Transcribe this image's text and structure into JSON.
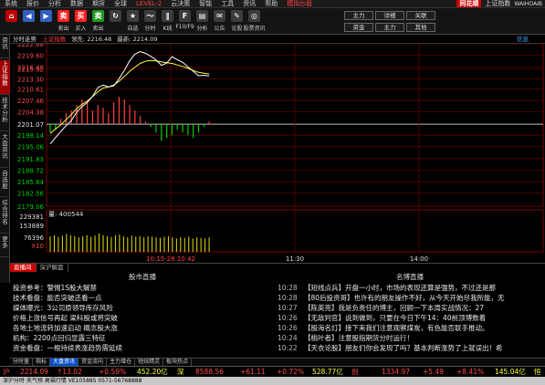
{
  "menu": {
    "items": [
      "系统",
      "报价",
      "分析",
      "数据",
      "期货",
      "全球",
      "LEVEL-2",
      "云决策",
      "智能",
      "工具",
      "资讯",
      "帮助"
    ],
    "highlight": "模拟炒股",
    "logo": "同花顺",
    "title": "上证指数",
    "right": "WAIHOAIB"
  },
  "toolbar": {
    "buttons": [
      {
        "label": "",
        "color": "#c00000",
        "glyph": "⌂"
      },
      {
        "label": "",
        "color": "#3060c0",
        "glyph": "◀"
      },
      {
        "label": "",
        "color": "#3060c0",
        "glyph": "▶"
      },
      {
        "label": "卖出",
        "color": "#ff2020",
        "glyph": "卖"
      },
      {
        "label": "买入",
        "color": "#ff2020",
        "glyph": "买"
      },
      {
        "label": "卖出",
        "color": "#1e9a1e",
        "glyph": "卖"
      },
      {
        "label": "",
        "color": "#3c3c3c",
        "glyph": "↻"
      },
      {
        "label": "自选",
        "color": "#3c3c3c",
        "glyph": "★"
      },
      {
        "label": "分时",
        "color": "#3c3c3c",
        "glyph": "〜"
      },
      {
        "label": "K线",
        "color": "#3c3c3c",
        "glyph": "‖"
      },
      {
        "label": "F10/F9",
        "color": "#3c3c3c",
        "glyph": "F"
      },
      {
        "label": "分析",
        "color": "#3c3c3c",
        "glyph": "▤"
      },
      {
        "label": "公告",
        "color": "#3c3c3c",
        "glyph": "✉"
      },
      {
        "label": "论股",
        "color": "#3c3c3c",
        "glyph": "✎"
      },
      {
        "label": "股票资讯",
        "color": "#3c3c3c",
        "glyph": "◎"
      }
    ],
    "right_buttons": [
      "主力",
      "详细",
      "关联",
      "资金",
      "主力",
      "其他"
    ]
  },
  "side_tabs": [
    "资讯",
    "上证指数",
    "技术分析",
    "大盘资讯",
    "自选股",
    "综合排名",
    "更多"
  ],
  "side_active": 1,
  "chart_header": {
    "name": "分时走势",
    "index": "上证指数",
    "lead_label": "领先: 2216.48",
    "latest_label": "最新: 2214.09",
    "info": "信息"
  },
  "volume_label": "量: 400544",
  "time_labels": [
    "10:15",
    "11:30",
    "14:00"
  ],
  "time_highlight": "10:15-28 10:42",
  "y_labels": [
    "2222.68",
    "2219.60",
    "2216.48",
    "2215.92",
    "2213.30",
    "2210.61",
    "2207.46",
    "2204.38",
    "2201.07",
    "2198.14",
    "2195.06",
    "2191.83",
    "2188.72",
    "2185.64",
    "2182.56",
    "2179.06"
  ],
  "vol_labels": [
    "229381",
    "153889",
    "76396",
    "X10"
  ],
  "chart_data": {
    "type": "line",
    "title": "上证指数 分时走势",
    "ylim": [
      2179.06,
      2222.68
    ],
    "base": 2201.07,
    "price": [
      2195.8,
      2197.5,
      2199.1,
      2200.7,
      2202.1,
      2204.3,
      2205.8,
      2206.9,
      2208.6,
      2210.9,
      2211.6,
      2211.1,
      2211.4,
      2213.3,
      2215.5,
      2218.1,
      2219.9,
      2220.6,
      2220.1,
      2219.3,
      2218.3,
      2216.9,
      2217.5,
      2219.2,
      2218.4,
      2217.7,
      2216.5,
      2215.3,
      2214.1,
      2214.2,
      2214.09
    ],
    "avg": [
      2198.6,
      2199.8,
      2200.9,
      2202.3,
      2203.7,
      2205.2,
      2206.4,
      2207.3,
      2208.5,
      2209.8,
      2210.8,
      2211.1,
      2211.6,
      2212.6,
      2213.9,
      2215.3,
      2216.4,
      2217.4,
      2218.0,
      2218.2,
      2218.1,
      2217.8,
      2217.6,
      2217.4,
      2217.0,
      2216.6,
      2216.1,
      2215.5,
      2215.0,
      2214.8,
      2214.6
    ],
    "momentum": [
      -3,
      -2,
      2,
      4,
      5,
      7,
      9,
      8,
      5,
      7,
      6,
      4,
      8,
      10,
      9,
      7,
      5,
      3,
      1,
      -1,
      -3,
      -6,
      -5,
      -4,
      -2,
      -3,
      -4,
      -5,
      -3,
      -1,
      1
    ],
    "volume": [
      0.28,
      0.3,
      0.27,
      0.29,
      0.32,
      0.3,
      0.28,
      0.26,
      0.28,
      0.3,
      0.27,
      0.29,
      0.33,
      0.3,
      0.28,
      0.27,
      0.3,
      0.31,
      0.28,
      0.26,
      0.29,
      0.27,
      0.28,
      0.26,
      0.28,
      0.27,
      0.26,
      0.25,
      0.27,
      0.28,
      0.26,
      0.24,
      0.26,
      0.25,
      0.27,
      0.24,
      0.26,
      0.25,
      0.24,
      0.26
    ]
  },
  "news_tabs": [
    "直播间",
    "深沪解盘"
  ],
  "news_tab_active": 0,
  "left_panel": {
    "title": "股市直播",
    "items": [
      "投资参考：警惕1S股大解禁",
      "技术看盘：能否突破还看一点",
      "媒体曝光：3公司原领导库存风险",
      "价格上涨信号再起  梁科股或将突破",
      "各地土地流转加速启动  概念股大涨",
      "机构：2200点回归显露三特征",
      "资金看盘：一根持续表涨趋势需延续"
    ]
  },
  "right_panel": {
    "title": "名博直播",
    "items": [
      {
        "time": "10:28",
        "text": "【短线点兵】开盘一小时，市场的表现还算是强势，不过还是那"
      },
      {
        "time": "10:28",
        "text": "【80后投资哥】也许有的朋友操作不好，从今天开始尽我所能，无"
      },
      {
        "time": "10:27",
        "text": "【陈英亮】我是负责任的博主，回顾一下本周实战情况：27"
      },
      {
        "time": "10:26",
        "text": "【无敌判官】说到做到，只要在今日下午14：40前顶博数着"
      },
      {
        "time": "10:26",
        "text": "【股海名灯】接下来我们注意观察煤炭，有色能否联手推动。"
      },
      {
        "time": "10:24",
        "text": "【桃叶者】注意股指期货分时运行！"
      },
      {
        "time": "10:22",
        "text": "【天衣论股】朋友们你会发现了吗？基本判断涨势了上就误出！希"
      }
    ]
  },
  "bottom_tabs": [
    "分时量",
    "指标",
    "大盘资讯",
    "资金流向",
    "主力增仓",
    "短线精灵",
    "板块热点"
  ],
  "bottom_active": 2,
  "ticker": {
    "sh_label": "沪",
    "sh_index": "2214.09",
    "sh_change": "↑13.02",
    "sh_pct": "+0.59%",
    "sh_amount": "452.20亿",
    "sz_label": "深",
    "sz_index": "8588.56",
    "sz_change": "+61.11",
    "sz_pct": "+0.72%",
    "sz_amount": "528.77亿",
    "cy_label": "创",
    "cy_index": "1334.97",
    "cy_change": "+5.49",
    "cy_pct": "+8.41%",
    "hk_amount": "145.04亿",
    "hk_label": "恒"
  },
  "status": "深沪分时  天气预  高福行情  VE105885  0571-56768888"
}
